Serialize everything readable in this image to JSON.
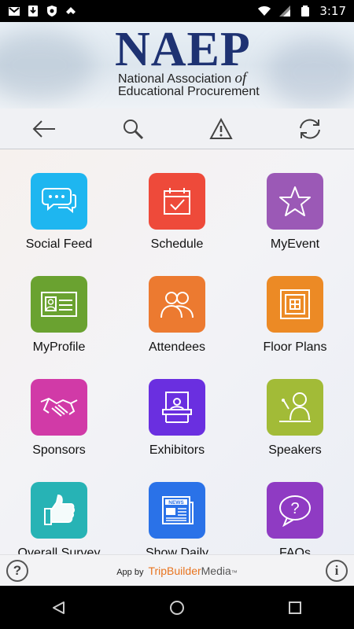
{
  "status_bar": {
    "time": "3:17"
  },
  "header": {
    "logo_word": "NAEP",
    "logo_line1_a": "National Association ",
    "logo_line1_b": "of",
    "logo_line2": "Educational Procurement"
  },
  "toolbar": {
    "icons": [
      "back-arrow-icon",
      "search-icon",
      "alert-icon",
      "sync-icon"
    ]
  },
  "tiles": [
    {
      "label": "Social Feed",
      "color": "#1eb6f0",
      "icon": "chat-bubbles-icon"
    },
    {
      "label": "Schedule",
      "color": "#ee4a3a",
      "icon": "calendar-check-icon"
    },
    {
      "label": "MyEvent",
      "color": "#9b59b6",
      "icon": "star-icon"
    },
    {
      "label": "MyProfile",
      "color": "#6aa230",
      "icon": "id-card-icon"
    },
    {
      "label": "Attendees",
      "color": "#ec7a30",
      "icon": "people-icon"
    },
    {
      "label": "Floor Plans",
      "color": "#ec8a25",
      "icon": "floor-plan-icon"
    },
    {
      "label": "Sponsors",
      "color": "#d13aa7",
      "icon": "handshake-icon"
    },
    {
      "label": "Exhibitors",
      "color": "#6a2fe0",
      "icon": "booth-icon"
    },
    {
      "label": "Speakers",
      "color": "#a2bb37",
      "icon": "speaker-icon"
    },
    {
      "label": "Overall Survey",
      "color": "#27b3b5",
      "icon": "thumbs-up-icon"
    },
    {
      "label": "Show Daily",
      "color": "#2a72e8",
      "icon": "newspaper-icon"
    },
    {
      "label": "FAQs",
      "color": "#8f3bc3",
      "icon": "question-bubble-icon"
    }
  ],
  "footer": {
    "help": "?",
    "info": "i",
    "app_by": "App by",
    "brand_a": "TripBuilder",
    "brand_b": "Media",
    "tm": "™"
  }
}
